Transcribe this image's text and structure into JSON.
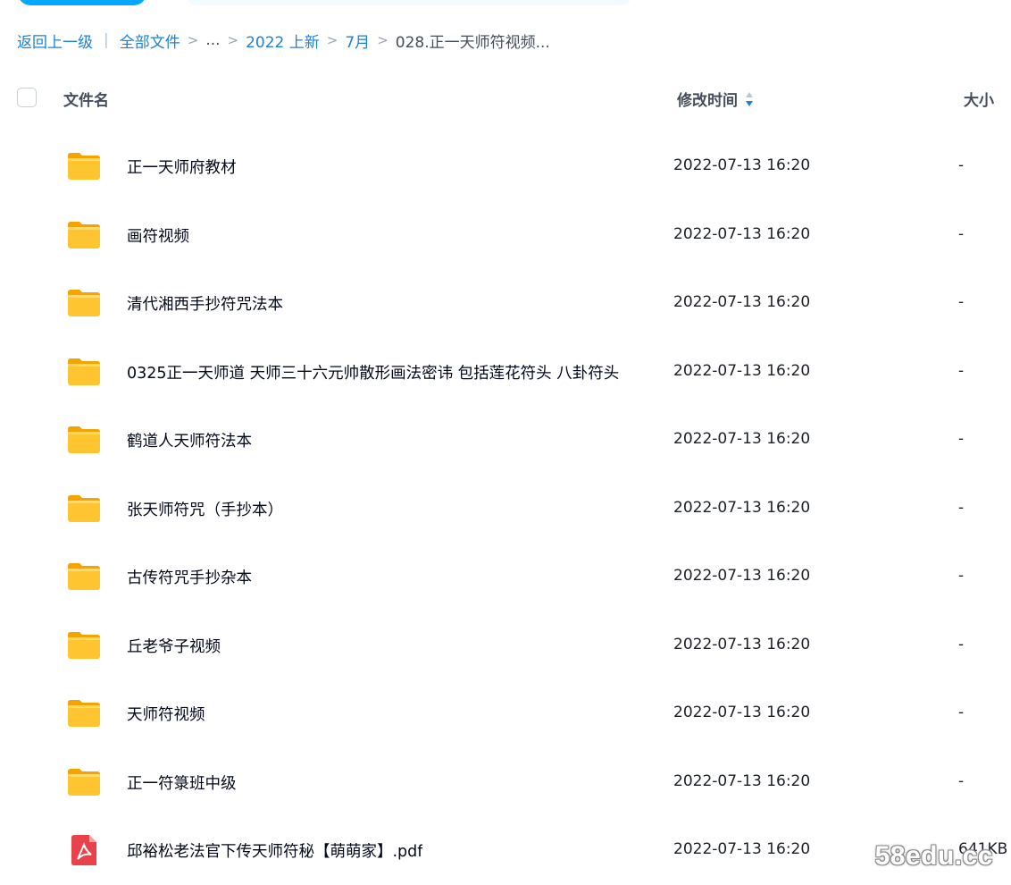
{
  "breadcrumb": {
    "back": "返回上一级",
    "separator": "|",
    "chevron": ">",
    "items": [
      "全部文件",
      "...",
      "2022 上新",
      "7月"
    ],
    "current": "028.正一天师符视频..."
  },
  "header": {
    "name": "文件名",
    "time": "修改时间",
    "size": "大小"
  },
  "files": [
    {
      "name": "正一天师府教材",
      "time": "2022-07-13 16:20",
      "size": "-",
      "icon": "folder-icon"
    },
    {
      "name": "画符视频",
      "time": "2022-07-13 16:20",
      "size": "-",
      "icon": "folder-icon"
    },
    {
      "name": "清代湘西手抄符咒法本",
      "time": "2022-07-13 16:20",
      "size": "-",
      "icon": "folder-icon"
    },
    {
      "name": "0325正一天师道 天师三十六元帅散形画法密讳 包括莲花符头 八卦符头",
      "time": "2022-07-13 16:20",
      "size": "-",
      "icon": "folder-icon"
    },
    {
      "name": "鹤道人天师符法本",
      "time": "2022-07-13 16:20",
      "size": "-",
      "icon": "folder-icon"
    },
    {
      "name": "张天师符咒（手抄本）",
      "time": "2022-07-13 16:20",
      "size": "-",
      "icon": "folder-icon"
    },
    {
      "name": "古传符咒手抄杂本",
      "time": "2022-07-13 16:20",
      "size": "-",
      "icon": "folder-icon"
    },
    {
      "name": "丘老爷子视频",
      "time": "2022-07-13 16:20",
      "size": "-",
      "icon": "folder-icon"
    },
    {
      "name": "天师符视频",
      "time": "2022-07-13 16:20",
      "size": "-",
      "icon": "folder-icon"
    },
    {
      "name": "正一符箓班中级",
      "time": "2022-07-13 16:20",
      "size": "-",
      "icon": "folder-icon"
    },
    {
      "name": "邱裕松老法官下传天师符秘【萌萌家】.pdf",
      "time": "2022-07-13 16:20",
      "size": "641KB",
      "icon": "pdf-icon"
    }
  ],
  "watermark": "58edu.cc",
  "colors": {
    "accent": "#1f80d6",
    "primary_button": "#06a7ff",
    "folder": "#ffc531",
    "pdf": "#e8424a"
  }
}
